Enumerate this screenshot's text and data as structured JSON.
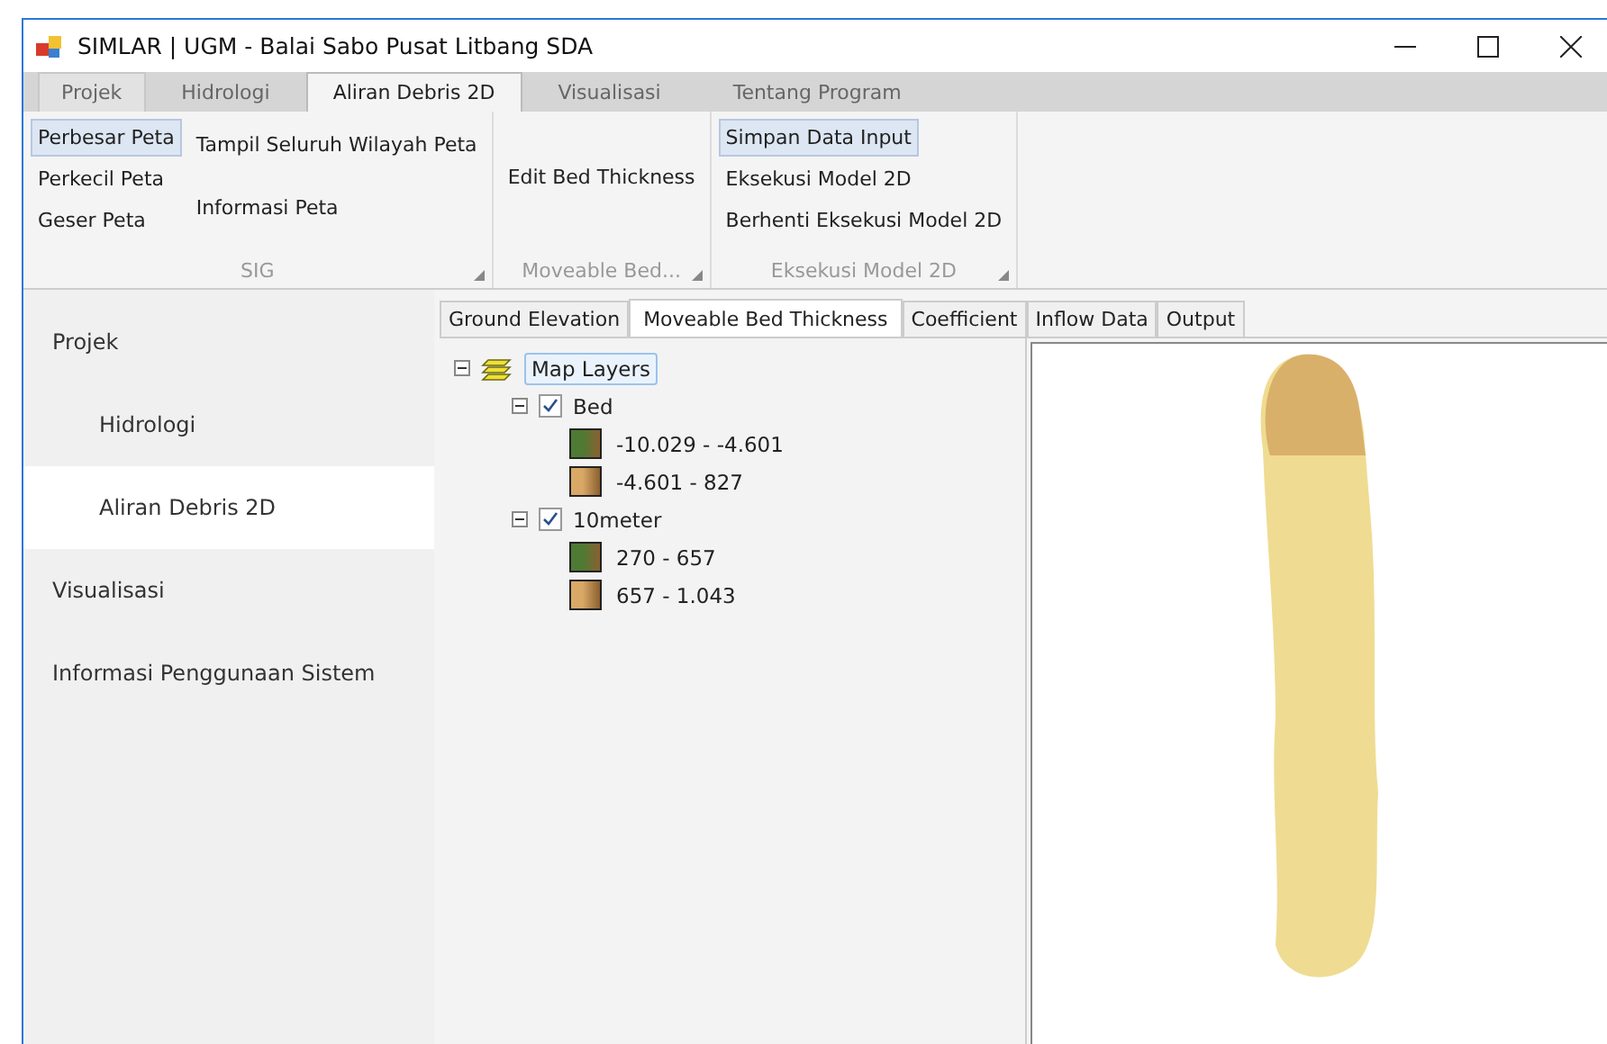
{
  "window": {
    "title": "SIMLAR | UGM - Balai Sabo Pusat Litbang SDA"
  },
  "ribbon_tabs": [
    {
      "label": "Projek",
      "selected": false
    },
    {
      "label": "Hidrologi",
      "selected": false
    },
    {
      "label": "Aliran Debris 2D",
      "selected": true
    },
    {
      "label": "Visualisasi",
      "selected": false
    },
    {
      "label": "Tentang Program",
      "selected": false
    }
  ],
  "ribbon_groups": [
    {
      "label": "SIG",
      "columns": [
        [
          {
            "label": "Perbesar Peta",
            "selected": true
          },
          {
            "label": "Perkecil Peta",
            "selected": false
          },
          {
            "label": "Geser Peta",
            "selected": false
          }
        ],
        [
          {
            "label": "Tampil Seluruh Wilayah Peta",
            "selected": false
          },
          {
            "label": "Informasi Peta",
            "selected": false
          }
        ]
      ]
    },
    {
      "label": "Moveable Bed...",
      "columns": [
        [
          {
            "label": "Edit Bed Thickness",
            "selected": false
          }
        ]
      ]
    },
    {
      "label": "Eksekusi Model 2D",
      "columns": [
        [
          {
            "label": "Simpan Data Input",
            "selected": true
          },
          {
            "label": "Eksekusi Model 2D",
            "selected": false
          },
          {
            "label": "Berhenti Eksekusi Model 2D",
            "selected": false
          }
        ]
      ]
    }
  ],
  "sidebar": {
    "items": [
      {
        "label": "Projek",
        "selected": false,
        "children": [
          {
            "label": "Hidrologi",
            "selected": false
          },
          {
            "label": "Aliran Debris 2D",
            "selected": true
          }
        ]
      },
      {
        "label": "Visualisasi",
        "selected": false
      },
      {
        "label": "Informasi Penggunaan Sistem",
        "selected": false
      }
    ]
  },
  "content_tabs": [
    {
      "label": "Ground Elevation",
      "selected": false
    },
    {
      "label": "Moveable Bed Thickness",
      "selected": true
    },
    {
      "label": "Coefficient",
      "selected": false
    },
    {
      "label": "Inflow Data",
      "selected": false
    },
    {
      "label": "Output",
      "selected": false
    }
  ],
  "layer_tree": {
    "label": "Map Layers",
    "expanded": true,
    "children": [
      {
        "label": "Bed",
        "expanded": true,
        "checked": true,
        "legend": [
          {
            "range": "-10.029 - -4.601",
            "color": "#4e7a34"
          },
          {
            "range": "-4.601 - 827",
            "color": "#d9a866"
          }
        ]
      },
      {
        "label": "10meter",
        "expanded": true,
        "checked": true,
        "legend": [
          {
            "range": "270 - 657",
            "color": "#4e7a34"
          },
          {
            "range": "657 - 1.043",
            "color": "#d9a866"
          }
        ]
      }
    ]
  }
}
